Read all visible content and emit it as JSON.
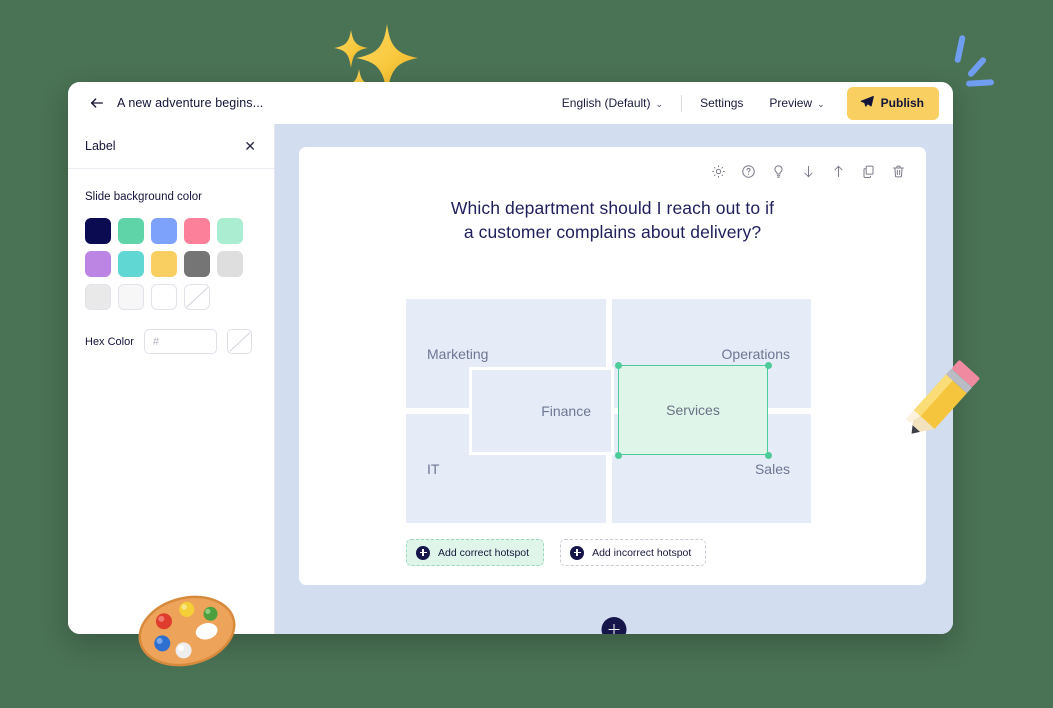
{
  "topbar": {
    "back_icon": "back-arrow-icon",
    "doc_title": "A new adventure begins...",
    "language": "English (Default)",
    "language_caret": "⌄",
    "settings": "Settings",
    "preview": "Preview",
    "preview_caret": "⌄",
    "publish": "Publish",
    "publish_icon": "send-plane-icon",
    "publish_bg": "#f8cf60"
  },
  "sidebar": {
    "panel_title": "Label",
    "close_icon": "close-icon",
    "close_glyph": "✕",
    "section_label": "Slide background color",
    "swatch_rows": [
      [
        {
          "name": "swatch-navy",
          "color": "#0b0b52"
        },
        {
          "name": "swatch-mint-green",
          "color": "#5fd4a8"
        },
        {
          "name": "swatch-cornflower-blue",
          "color": "#7da2fb"
        },
        {
          "name": "swatch-pink",
          "color": "#fc8099"
        },
        {
          "name": "swatch-pale-mint",
          "color": "#aaedd0"
        }
      ],
      [
        {
          "name": "swatch-purple",
          "color": "#bd85e3"
        },
        {
          "name": "swatch-turquoise",
          "color": "#61d7d4"
        },
        {
          "name": "swatch-yellow",
          "color": "#f8cf60"
        },
        {
          "name": "swatch-dark-gray",
          "color": "#757575"
        },
        {
          "name": "swatch-light-gray",
          "color": "#dedede"
        }
      ],
      [
        {
          "name": "swatch-off-white",
          "color": "#e9e9e9"
        },
        {
          "name": "swatch-near-white",
          "color": "#f7f7f8"
        },
        {
          "name": "swatch-white",
          "color": "#ffffff"
        },
        {
          "name": "swatch-none",
          "color": "#ffffff",
          "slash": true
        }
      ]
    ],
    "hex_label": "Hex Color",
    "hex_value": "",
    "hex_placeholder": "#",
    "hex_none_name": "hex-no-color-swatch"
  },
  "canvas": {
    "background": "#d3ddf0",
    "slide_toolbar": [
      {
        "name": "settings-gear-icon",
        "title": "Settings"
      },
      {
        "name": "help-circle-icon",
        "title": "Help"
      },
      {
        "name": "lightbulb-icon",
        "title": "Hint"
      },
      {
        "name": "move-down-arrow-icon",
        "title": "Move down"
      },
      {
        "name": "move-up-arrow-icon",
        "title": "Move up"
      },
      {
        "name": "duplicate-icon",
        "title": "Duplicate"
      },
      {
        "name": "trash-icon",
        "title": "Delete"
      }
    ],
    "question_line1": "Which department should I reach out to if",
    "question_line2": "a customer complains about delivery?",
    "hotspot_tiles": [
      {
        "name": "tile-marketing",
        "label": "Marketing"
      },
      {
        "name": "tile-operations",
        "label": "Operations"
      },
      {
        "name": "tile-finance",
        "label": "Finance"
      },
      {
        "name": "tile-it",
        "label": "IT"
      },
      {
        "name": "tile-sales",
        "label": "Sales"
      }
    ],
    "selected_hotspot": {
      "label": "Services",
      "border_color": "#4ecb9a",
      "fill_color": "#dff5ea"
    },
    "add_correct_hotspot": "Add correct hotspot",
    "add_incorrect_hotspot": "Add incorrect hotspot",
    "add_slide_icon": "plus-icon"
  },
  "decorations": [
    {
      "name": "sparkles-emoji"
    },
    {
      "name": "blue-dashes-decoration"
    },
    {
      "name": "pencil-emoji"
    },
    {
      "name": "artist-palette-emoji"
    }
  ],
  "page": {
    "background": "#4a7254"
  }
}
